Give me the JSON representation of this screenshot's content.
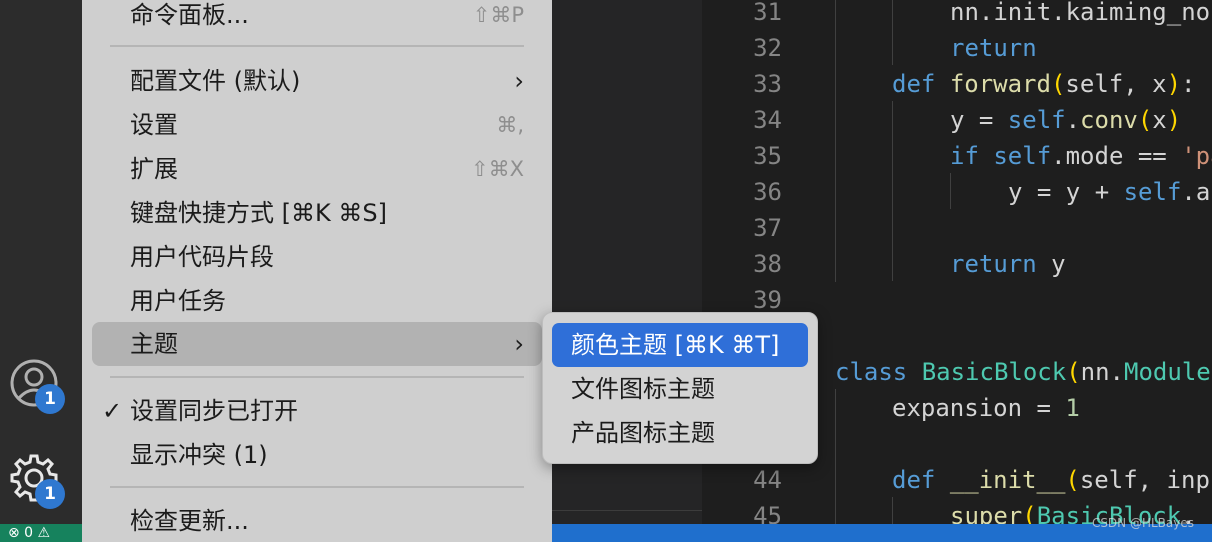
{
  "activity_bar": {
    "accounts_badge": "1",
    "manage_badge": "1",
    "status_left_text": "⊗ 0 ⚠"
  },
  "menu": {
    "command_palette": {
      "label": "命令面板...",
      "shortcut": "⇧⌘P"
    },
    "profiles": {
      "label": "配置文件 (默认)"
    },
    "settings": {
      "label": "设置",
      "shortcut": "⌘,"
    },
    "extensions": {
      "label": "扩展",
      "shortcut": "⇧⌘X"
    },
    "keyboard_shortcuts": {
      "label": "键盘快捷方式 [⌘K ⌘S]"
    },
    "user_snippets": {
      "label": "用户代码片段"
    },
    "user_tasks": {
      "label": "用户任务"
    },
    "themes": {
      "label": "主题"
    },
    "settings_sync": {
      "label": "设置同步已打开",
      "check": "✓"
    },
    "show_conflicts": {
      "label": "显示冲突 (1)"
    },
    "check_updates": {
      "label": "检查更新..."
    }
  },
  "submenu": {
    "color_theme": "颜色主题 [⌘K ⌘T]",
    "file_icon_theme": "文件图标主题",
    "product_icon_theme": "产品图标主题"
  },
  "editor": {
    "lines": [
      {
        "n": "31",
        "text": "nn.init.kaiming_no"
      },
      {
        "n": "32",
        "text": "return"
      },
      {
        "n": "33",
        "text": "def forward(self, x):"
      },
      {
        "n": "34",
        "text": "y = self.conv(x)"
      },
      {
        "n": "35",
        "text": "if self.mode == 'pa"
      },
      {
        "n": "36",
        "text": "y = y + self.ac"
      },
      {
        "n": "37",
        "text": ""
      },
      {
        "n": "38",
        "text": "return y"
      },
      {
        "n": "39",
        "text": ""
      },
      {
        "n": "",
        "text": "class BasicBlock(nn.Module"
      },
      {
        "n": "",
        "text": "expansion = 1"
      },
      {
        "n": "",
        "text": ""
      },
      {
        "n": "44",
        "text": "def __init__(self, inp"
      },
      {
        "n": "45",
        "text": "super(BasicBlock,"
      }
    ]
  },
  "watermark": "CSDN @HLBayes",
  "colors": {
    "menu_bg": "#cfcfcf",
    "highlight": "#2f6fd8",
    "badge": "#2f78d0",
    "status_bar": "#1f6fcd",
    "status_left": "#16825d"
  }
}
